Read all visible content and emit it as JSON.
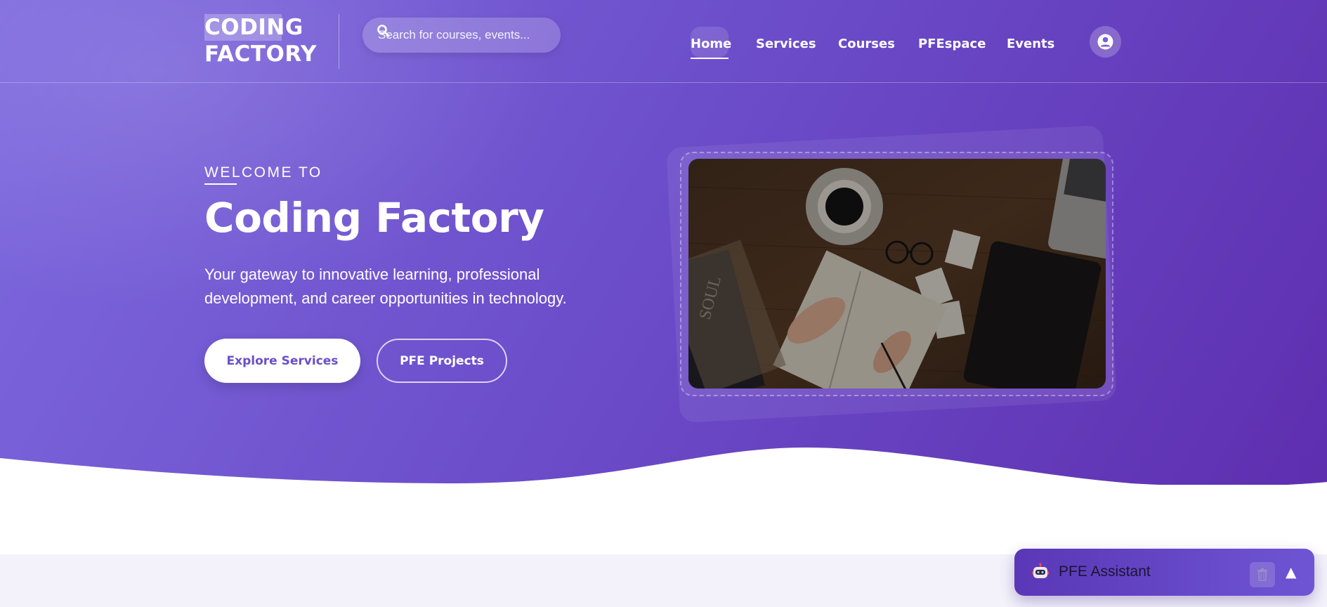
{
  "brand": {
    "line1": "CODING",
    "line2": "FACTORY"
  },
  "search": {
    "placeholder": "Search for courses, events..."
  },
  "nav": {
    "items": [
      {
        "label": "Home",
        "active": true
      },
      {
        "label": "Services"
      },
      {
        "label": "Courses"
      },
      {
        "label": "PFEspace"
      },
      {
        "label": "Events"
      }
    ]
  },
  "profile": {
    "icon": "user-circle-icon"
  },
  "hero": {
    "kicker": "WELCOME TO",
    "title": "Coding Factory",
    "subtitle": "Your gateway to innovative learning, professional development, and career opportunities in technology.",
    "primary_cta": "Explore Services",
    "secondary_cta": "PFE Projects",
    "image_icon": "desk-workspace-photo"
  },
  "assistant": {
    "label": "PFE Assistant",
    "avatar_icon": "robot-icon",
    "clear_icon": "trash-icon",
    "toggle_symbol": "▲"
  },
  "colors": {
    "hero_start": "#7e6adf",
    "hero_end": "#5e2fb0",
    "primary_text": "#6a4fc8",
    "assistant_start": "#5a37b6",
    "assistant_end": "#6e55d4"
  }
}
